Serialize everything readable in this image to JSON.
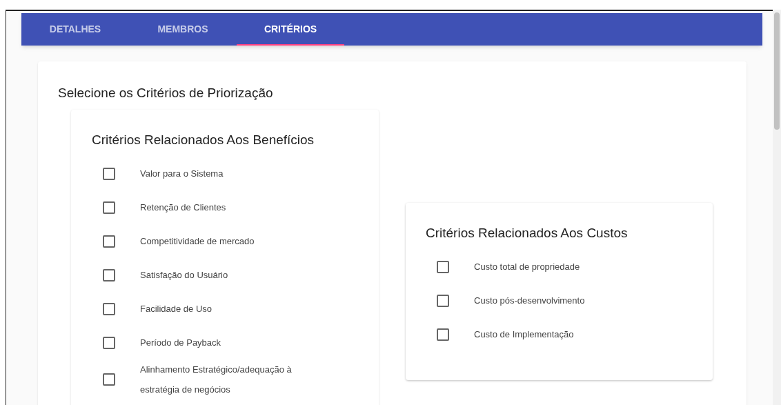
{
  "tabs": [
    {
      "label": "DETALHES",
      "selected": false
    },
    {
      "label": "MEMBROS",
      "selected": false
    },
    {
      "label": "CRITÉRIOS",
      "selected": true
    }
  ],
  "title": "Selecione os Critérios de Priorização",
  "groups": [
    {
      "title": "Critérios Relacionados Aos Benefícios",
      "items": [
        {
          "label": "Valor para o Sistema",
          "checked": false
        },
        {
          "label": "Retenção de Clientes",
          "checked": false
        },
        {
          "label": "Competitividade de mercado",
          "checked": false
        },
        {
          "label": "Satisfação do Usuário",
          "checked": false
        },
        {
          "label": "Facilidade de Uso",
          "checked": false
        },
        {
          "label": "Período de Payback",
          "checked": false
        },
        {
          "label": "Alinhamento Estratégico/adequação à estratégia de negócios",
          "checked": false
        }
      ]
    },
    {
      "title": "Critérios Relacionados Aos Custos",
      "items": [
        {
          "label": "Custo total de propriedade",
          "checked": false
        },
        {
          "label": "Custo pós-desenvolvimento",
          "checked": false
        },
        {
          "label": "Custo de Implementação",
          "checked": false
        }
      ]
    }
  ]
}
